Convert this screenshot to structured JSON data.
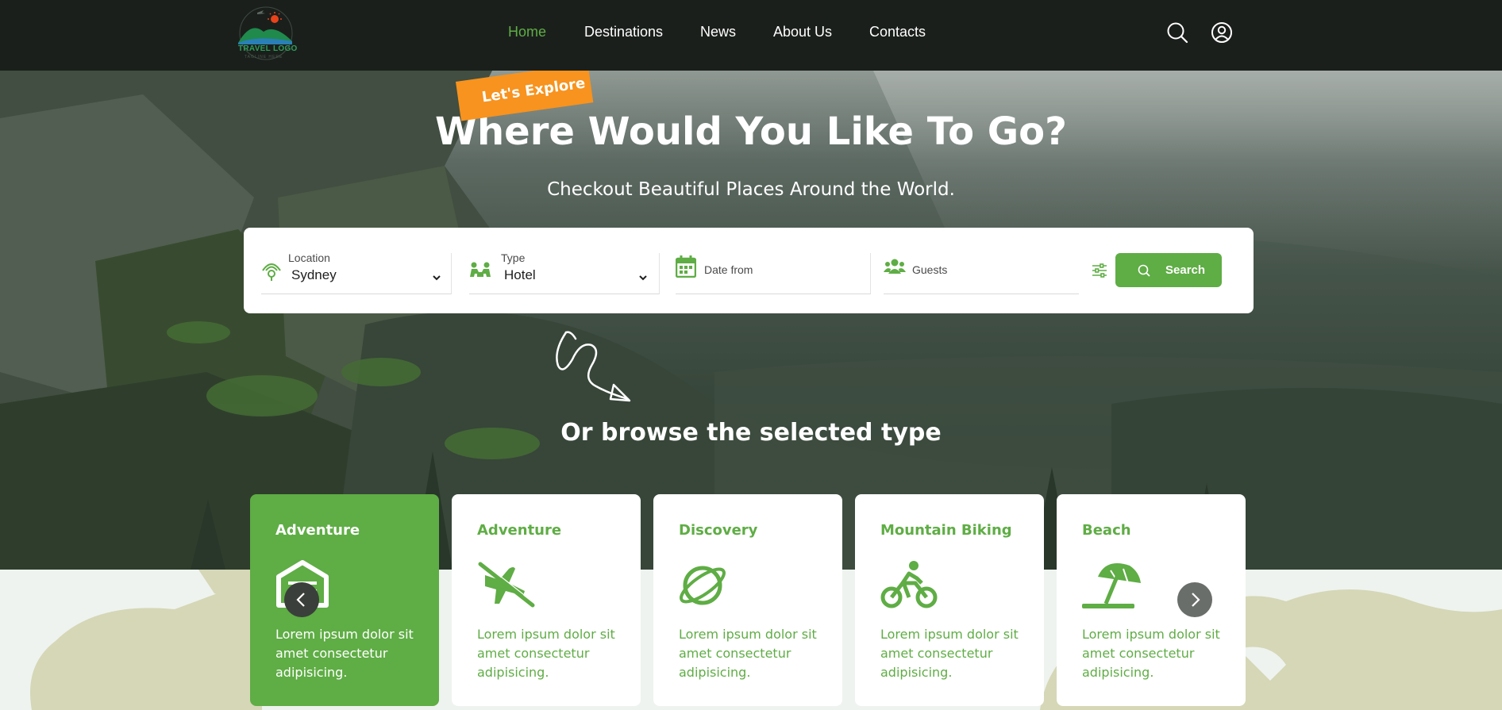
{
  "nav": {
    "logo_text": "TRAVEL LOGO",
    "logo_sub": "TAGLINE HERE",
    "items": [
      {
        "label": "Home",
        "active": true
      },
      {
        "label": "Destinations",
        "active": false
      },
      {
        "label": "News",
        "active": false
      },
      {
        "label": "About Us",
        "active": false
      },
      {
        "label": "Contacts",
        "active": false
      }
    ],
    "icons": [
      "search-icon",
      "user-account-icon"
    ]
  },
  "hero": {
    "tag": "Let's Explore",
    "title": "Where Would You Like To Go?",
    "subtitle": "Checkout Beautiful Places Around the World."
  },
  "search": {
    "location": {
      "label": "Location",
      "value": "Sydney",
      "icon": "location-pin-icon"
    },
    "type": {
      "label": "Type",
      "value": "Hotel",
      "icon": "people-icon"
    },
    "date": {
      "placeholder": "Date from",
      "icon": "calendar-icon"
    },
    "guests": {
      "placeholder": "Guests",
      "icon": "guests-icon"
    },
    "filter_icon": "sliders-icon",
    "button_label": "Search"
  },
  "browse_heading": "Or browse the selected type",
  "categories": [
    {
      "title": "Adventure",
      "icon": "garage-icon",
      "desc": "Lorem ipsum dolor sit amet consectetur adipisicing.",
      "active": true
    },
    {
      "title": "Adventure",
      "icon": "plane-off-icon",
      "desc": "Lorem ipsum dolor sit amet consectetur adipisicing.",
      "active": false
    },
    {
      "title": "Discovery",
      "icon": "planet-icon",
      "desc": "Lorem ipsum dolor sit amet consectetur adipisicing.",
      "active": false
    },
    {
      "title": "Mountain Biking",
      "icon": "bicycle-icon",
      "desc": "Lorem ipsum dolor sit amet consectetur adipisicing.",
      "active": false
    },
    {
      "title": "Beach",
      "icon": "umbrella-beach-icon",
      "desc": "Lorem ipsum dolor sit amet consectetur adipisicing.",
      "active": false
    }
  ],
  "colors": {
    "accent": "#5fad45",
    "tag": "#f7931e",
    "nav_bg": "#1b1f1c"
  }
}
